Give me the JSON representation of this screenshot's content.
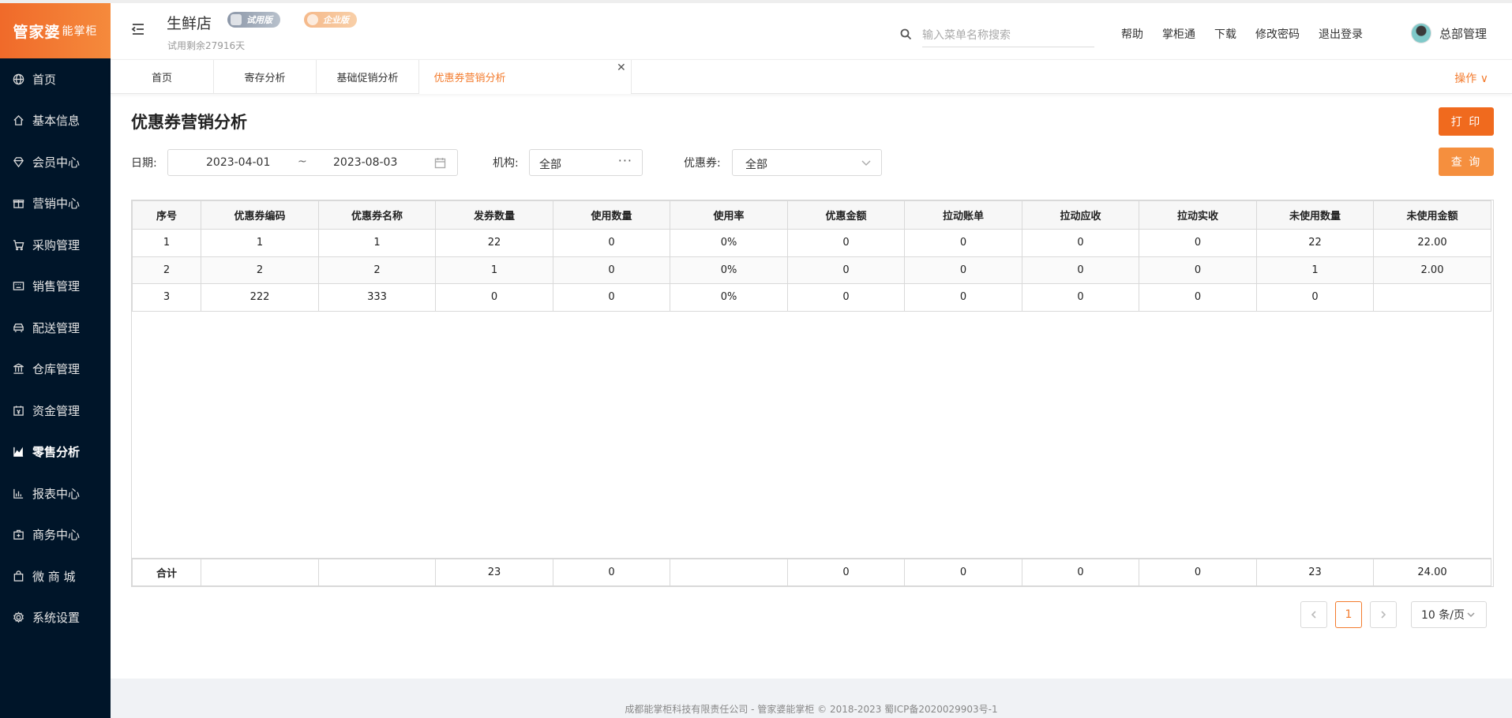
{
  "app": {
    "logo_main": "管家婆",
    "logo_sub": "能掌柜"
  },
  "sidebar": {
    "items": [
      {
        "label": "首页",
        "icon": "globe-icon"
      },
      {
        "label": "基本信息",
        "icon": "home-icon"
      },
      {
        "label": "会员中心",
        "icon": "diamond-icon"
      },
      {
        "label": "营销中心",
        "icon": "gift-icon"
      },
      {
        "label": "采购管理",
        "icon": "cart-icon"
      },
      {
        "label": "销售管理",
        "icon": "keyboard-icon"
      },
      {
        "label": "配送管理",
        "icon": "car-icon"
      },
      {
        "label": "仓库管理",
        "icon": "bank-icon"
      },
      {
        "label": "资金管理",
        "icon": "calendar-yen-icon"
      },
      {
        "label": "零售分析",
        "icon": "area-chart-icon"
      },
      {
        "label": "报表中心",
        "icon": "bar-chart-icon"
      },
      {
        "label": "商务中心",
        "icon": "briefcase-plus-icon"
      },
      {
        "label": "微 商 城",
        "icon": "shopping-bag-icon"
      },
      {
        "label": "系统设置",
        "icon": "settings-icon"
      }
    ],
    "active_index": 9
  },
  "header": {
    "store_name": "生鲜店",
    "badge_trial": "试用版",
    "badge_enterprise": "企业版",
    "trial_left": "试用剩余27916天",
    "search_placeholder": "输入菜单名称搜索",
    "links": [
      "帮助",
      "掌柜通",
      "下载",
      "修改密码",
      "退出登录"
    ],
    "user_name": "总部管理"
  },
  "tabs": {
    "items": [
      "首页",
      "寄存分析",
      "基础促销分析",
      "优惠券营销分析"
    ],
    "active_index": 3,
    "ops_label": "操作"
  },
  "page": {
    "title": "优惠券营销分析",
    "print_button": "打 印",
    "query_button": "查 询"
  },
  "filters": {
    "date_label": "日期:",
    "date_start": "2023-04-01",
    "date_sep": "~",
    "date_end": "2023-08-03",
    "org_label": "机构:",
    "org_value": "全部",
    "coupon_label": "优惠券:",
    "coupon_value": "全部"
  },
  "table": {
    "headers": [
      "序号",
      "优惠券编码",
      "优惠券名称",
      "发券数量",
      "使用数量",
      "使用率",
      "优惠金额",
      "拉动账单",
      "拉动应收",
      "拉动实收",
      "未使用数量",
      "未使用金额"
    ],
    "rows": [
      [
        "1",
        "1",
        "1",
        "22",
        "0",
        "0%",
        "0",
        "0",
        "0",
        "0",
        "22",
        "22.00"
      ],
      [
        "2",
        "2",
        "2",
        "1",
        "0",
        "0%",
        "0",
        "0",
        "0",
        "0",
        "1",
        "2.00"
      ],
      [
        "3",
        "222",
        "333",
        "0",
        "0",
        "0%",
        "0",
        "0",
        "0",
        "0",
        "0",
        ""
      ]
    ],
    "summary": [
      "合计",
      "",
      "",
      "23",
      "0",
      "",
      "0",
      "0",
      "0",
      "0",
      "23",
      "24.00"
    ]
  },
  "pagination": {
    "current_page": "1",
    "page_size": "10 条/页"
  },
  "footer": {
    "text": "成都能掌柜科技有限责任公司 - 管家婆能掌柜 © 2018-2023 蜀ICP备2020029903号-1"
  },
  "colors": {
    "accent": "#f37b2d",
    "sidebar_bg": "#001529"
  }
}
